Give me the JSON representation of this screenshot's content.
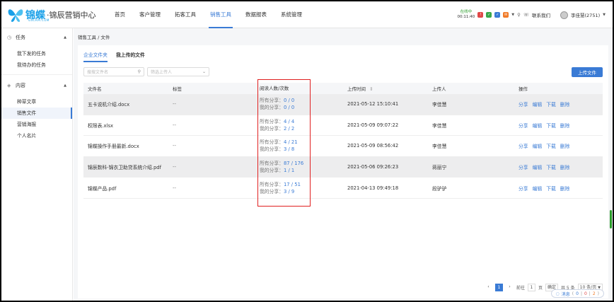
{
  "brand": {
    "name": "锦蝶",
    "subtitle": "·锦辰营销中心",
    "url": "GSCRM.COM"
  },
  "nav": [
    "首页",
    "客户管理",
    "拓客工具",
    "销售工具",
    "数据报表",
    "系统管理"
  ],
  "nav_active_index": 3,
  "topright": {
    "status": "在线中",
    "timer": "00:11:40",
    "contact": "联系我们",
    "user": "李佳慧(2751)",
    "icon_colors": [
      "#e04848",
      "#3aa84a",
      "#3a7bd5",
      "#f07a28"
    ]
  },
  "sidebar": {
    "group1": "任务",
    "group1_items": [
      "我下发的任务",
      "我待办的任务"
    ],
    "group2": "内容",
    "group2_items": [
      "种草文章",
      "销售文件",
      "营销海报",
      "个人名片"
    ],
    "active_item": "销售文件"
  },
  "breadcrumb": "销售工具  /  文件",
  "tabs": [
    "企业文件夹",
    "我上传的文件"
  ],
  "filters": {
    "search_placeholder": "搜搜文件名",
    "uploader_placeholder": "筛选上传人"
  },
  "upload_button": "上传文件",
  "table": {
    "headers": [
      "文件名",
      "标签",
      "阅读人数/次数",
      "上传时间",
      "上传人",
      "操作"
    ],
    "sort_indicator": "⇕",
    "share_all_label": "所有分享：",
    "share_mine_label": "我的分享：",
    "rows": [
      {
        "name": "五卡说机介绍.docx",
        "tag": "--",
        "all": "0 / 0",
        "mine": "0 / 0",
        "time": "2021-05-12 15:10:41",
        "uploader": "李佳慧"
      },
      {
        "name": "权限表.xlsx",
        "tag": "--",
        "all": "4 / 4",
        "mine": "2 / 2",
        "time": "2021-05-09 09:07:22",
        "uploader": "李佳慧"
      },
      {
        "name": "锦蝶操作手册最新.docx",
        "tag": "--",
        "all": "4 / 21",
        "mine": "3 / 8",
        "time": "2021-05-09 08:56:42",
        "uploader": "李佳慧"
      },
      {
        "name": "锦辰数科-锦衣卫助贷系统介绍.pdf",
        "tag": "--",
        "all": "87 / 176",
        "mine": "1 / 1",
        "time": "2021-05-06 09:26:23",
        "uploader": "蒋丽宁"
      },
      {
        "name": "锦蝶产品.pdf",
        "tag": "--",
        "all": "17 / 51",
        "mine": "3 / 9",
        "time": "2021-04-13 09:49:18",
        "uploader": "段驴驴"
      }
    ],
    "actions": [
      "分享",
      "编辑",
      "下载",
      "删除"
    ]
  },
  "pager": {
    "prev": "‹",
    "current": "1",
    "next": "›",
    "goto_label": "前往",
    "goto_value": "1",
    "page_unit": "页",
    "confirm": "确定",
    "total": "共 5 条",
    "page_size": "10 条/页"
  },
  "messages": {
    "label": "消息",
    "counts": [
      "0",
      "0",
      "2"
    ]
  }
}
